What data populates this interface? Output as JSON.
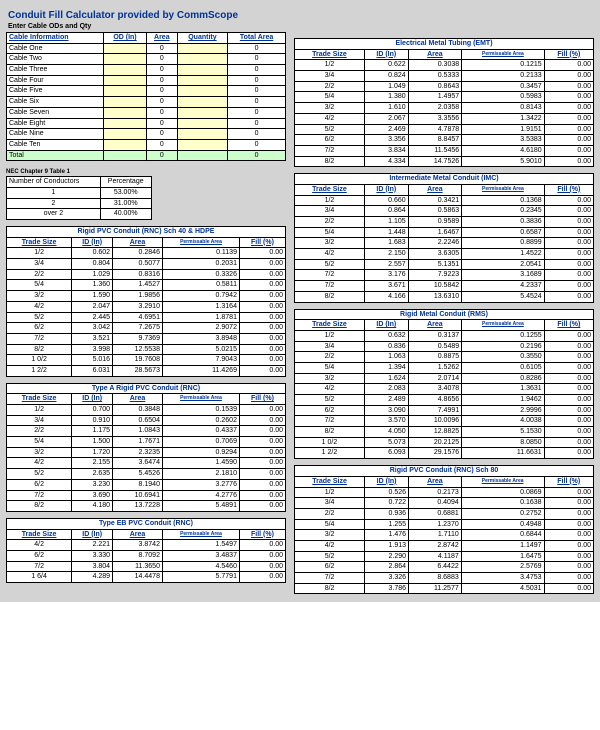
{
  "title": "Conduit Fill Calculator provided by CommScope",
  "enterLabel": "Enter Cable ODs and Qty",
  "cableHeader": [
    "Cable Information",
    "OD (In)",
    "Area",
    "Quantity",
    "Total Area"
  ],
  "cables": [
    "Cable One",
    "Cable Two",
    "Cable Three",
    "Cable Four",
    "Cable Five",
    "Cable Six",
    "Cable Seven",
    "Cable Eight",
    "Cable Nine",
    "Cable Ten"
  ],
  "total": "Total",
  "necTitle": "NEC Chapter 9 Table 1",
  "nec": {
    "h": [
      "Number of Conductors",
      "Percentage"
    ],
    "r": [
      [
        "1",
        "53.00%"
      ],
      [
        "2",
        "31.00%"
      ],
      [
        "over 2",
        "40.00%"
      ]
    ]
  },
  "h5": [
    "Trade Size",
    "ID (In)",
    "Area",
    "Permissable Area",
    "Fill (%)"
  ],
  "tables": [
    {
      "side": "L",
      "title": "Rigid PVC Conduit (RNC) Sch 40 & HDPE",
      "rows": [
        [
          "1/2",
          "0.602",
          "0.2846",
          "0.1139",
          "0.00"
        ],
        [
          "3/4",
          "0.804",
          "0.5077",
          "0.2031",
          "0.00"
        ],
        [
          "2/2",
          "1.029",
          "0.8316",
          "0.3326",
          "0.00"
        ],
        [
          "5/4",
          "1.360",
          "1.4527",
          "0.5811",
          "0.00"
        ],
        [
          "3/2",
          "1.590",
          "1.9856",
          "0.7942",
          "0.00"
        ],
        [
          "4/2",
          "2.047",
          "3.2910",
          "1.3164",
          "0.00"
        ],
        [
          "5/2",
          "2.445",
          "4.6951",
          "1.8781",
          "0.00"
        ],
        [
          "6/2",
          "3.042",
          "7.2675",
          "2.9072",
          "0.00"
        ],
        [
          "7/2",
          "3.521",
          "9.7369",
          "3.8948",
          "0.00"
        ],
        [
          "8/2",
          "3.998",
          "12.5538",
          "5.0215",
          "0.00"
        ],
        [
          "1 0/2",
          "5.016",
          "19.7608",
          "7.9043",
          "0.00"
        ],
        [
          "1 2/2",
          "6.031",
          "28.5673",
          "11.4269",
          "0.00"
        ]
      ]
    },
    {
      "side": "L",
      "title": "Type A Rigid PVC Conduit (RNC)",
      "rows": [
        [
          "1/2",
          "0.700",
          "0.3848",
          "0.1539",
          "0.00"
        ],
        [
          "3/4",
          "0.910",
          "0.6504",
          "0.2602",
          "0.00"
        ],
        [
          "2/2",
          "1.175",
          "1.0843",
          "0.4337",
          "0.00"
        ],
        [
          "5/4",
          "1.500",
          "1.7671",
          "0.7069",
          "0.00"
        ],
        [
          "3/2",
          "1.720",
          "2.3235",
          "0.9294",
          "0.00"
        ],
        [
          "4/2",
          "2.155",
          "3.6474",
          "1.4590",
          "0.00"
        ],
        [
          "5/2",
          "2.635",
          "5.4526",
          "2.1810",
          "0.00"
        ],
        [
          "6/2",
          "3.230",
          "8.1940",
          "3.2776",
          "0.00"
        ],
        [
          "7/2",
          "3.690",
          "10.6941",
          "4.2776",
          "0.00"
        ],
        [
          "8/2",
          "4.180",
          "13.7228",
          "5.4891",
          "0.00"
        ]
      ]
    },
    {
      "side": "L",
      "title": "Type EB PVC Conduit (RNC)",
      "rows": [
        [
          "4/2",
          "2.221",
          "3.8742",
          "1.5497",
          "0.00"
        ],
        [
          "6/2",
          "3.330",
          "8.7092",
          "3.4837",
          "0.00"
        ],
        [
          "7/2",
          "3.804",
          "11.3650",
          "4.5460",
          "0.00"
        ],
        [
          "1 6/4",
          "4.289",
          "14.4478",
          "5.7791",
          "0.00"
        ]
      ]
    },
    {
      "side": "R",
      "title": "Electrical Metal Tubing (EMT)",
      "rows": [
        [
          "1/2",
          "0.622",
          "0.3038",
          "0.1215",
          "0.00"
        ],
        [
          "3/4",
          "0.824",
          "0.5333",
          "0.2133",
          "0.00"
        ],
        [
          "2/2",
          "1.049",
          "0.8643",
          "0.3457",
          "0.00"
        ],
        [
          "5/4",
          "1.380",
          "1.4957",
          "0.5983",
          "0.00"
        ],
        [
          "3/2",
          "1.610",
          "2.0358",
          "0.8143",
          "0.00"
        ],
        [
          "4/2",
          "2.067",
          "3.3556",
          "1.3422",
          "0.00"
        ],
        [
          "5/2",
          "2.469",
          "4.7878",
          "1.9151",
          "0.00"
        ],
        [
          "6/2",
          "3.356",
          "8.8457",
          "3.5383",
          "0.00"
        ],
        [
          "7/2",
          "3.834",
          "11.5456",
          "4.6180",
          "0.00"
        ],
        [
          "8/2",
          "4.334",
          "14.7526",
          "5.9010",
          "0.00"
        ]
      ]
    },
    {
      "side": "R",
      "title": "Intermediate Metal Conduit (IMC)",
      "rows": [
        [
          "1/2",
          "0.660",
          "0.3421",
          "0.1368",
          "0.00"
        ],
        [
          "3/4",
          "0.864",
          "0.5863",
          "0.2345",
          "0.00"
        ],
        [
          "2/2",
          "1.105",
          "0.9589",
          "0.3836",
          "0.00"
        ],
        [
          "5/4",
          "1.448",
          "1.6467",
          "0.6587",
          "0.00"
        ],
        [
          "3/2",
          "1.683",
          "2.2246",
          "0.8899",
          "0.00"
        ],
        [
          "4/2",
          "2.150",
          "3.6305",
          "1.4522",
          "0.00"
        ],
        [
          "5/2",
          "2.557",
          "5.1351",
          "2.0541",
          "0.00"
        ],
        [
          "7/2",
          "3.176",
          "7.9223",
          "3.1689",
          "0.00"
        ],
        [
          "7/2",
          "3.671",
          "10.5842",
          "4.2337",
          "0.00"
        ],
        [
          "8/2",
          "4.166",
          "13.6310",
          "5.4524",
          "0.00"
        ]
      ]
    },
    {
      "side": "R",
      "title": "Rigid Metal Conduit (RMS)",
      "rows": [
        [
          "1/2",
          "0.632",
          "0.3137",
          "0.1255",
          "0.00"
        ],
        [
          "3/4",
          "0.836",
          "0.5489",
          "0.2196",
          "0.00"
        ],
        [
          "2/2",
          "1.063",
          "0.8875",
          "0.3550",
          "0.00"
        ],
        [
          "5/4",
          "1.394",
          "1.5262",
          "0.6105",
          "0.00"
        ],
        [
          "3/2",
          "1.624",
          "2.0714",
          "0.8286",
          "0.00"
        ],
        [
          "4/2",
          "2.083",
          "3.4078",
          "1.3631",
          "0.00"
        ],
        [
          "5/2",
          "2.489",
          "4.8656",
          "1.9462",
          "0.00"
        ],
        [
          "6/2",
          "3.090",
          "7.4991",
          "2.9996",
          "0.00"
        ],
        [
          "7/2",
          "3.570",
          "10.0096",
          "4.0038",
          "0.00"
        ],
        [
          "8/2",
          "4.050",
          "12.8825",
          "5.1530",
          "0.00"
        ],
        [
          "1 0/2",
          "5.073",
          "20.2125",
          "8.0850",
          "0.00"
        ],
        [
          "1 2/2",
          "6.093",
          "29.1576",
          "11.6631",
          "0.00"
        ]
      ]
    },
    {
      "side": "R",
      "title": "Rigid PVC Conduit (RNC) Sch 80",
      "rows": [
        [
          "1/2",
          "0.526",
          "0.2173",
          "0.0869",
          "0.00"
        ],
        [
          "3/4",
          "0.722",
          "0.4094",
          "0.1638",
          "0.00"
        ],
        [
          "2/2",
          "0.936",
          "0.6881",
          "0.2752",
          "0.00"
        ],
        [
          "5/4",
          "1.255",
          "1.2370",
          "0.4948",
          "0.00"
        ],
        [
          "3/2",
          "1.476",
          "1.7110",
          "0.6844",
          "0.00"
        ],
        [
          "4/2",
          "1.913",
          "2.8742",
          "1.1497",
          "0.00"
        ],
        [
          "5/2",
          "2.290",
          "4.1187",
          "1.6475",
          "0.00"
        ],
        [
          "6/2",
          "2.864",
          "6.4422",
          "2.5769",
          "0.00"
        ],
        [
          "7/2",
          "3.326",
          "8.6883",
          "3.4753",
          "0.00"
        ],
        [
          "8/2",
          "3.786",
          "11.2577",
          "4.5031",
          "0.00"
        ]
      ]
    }
  ]
}
